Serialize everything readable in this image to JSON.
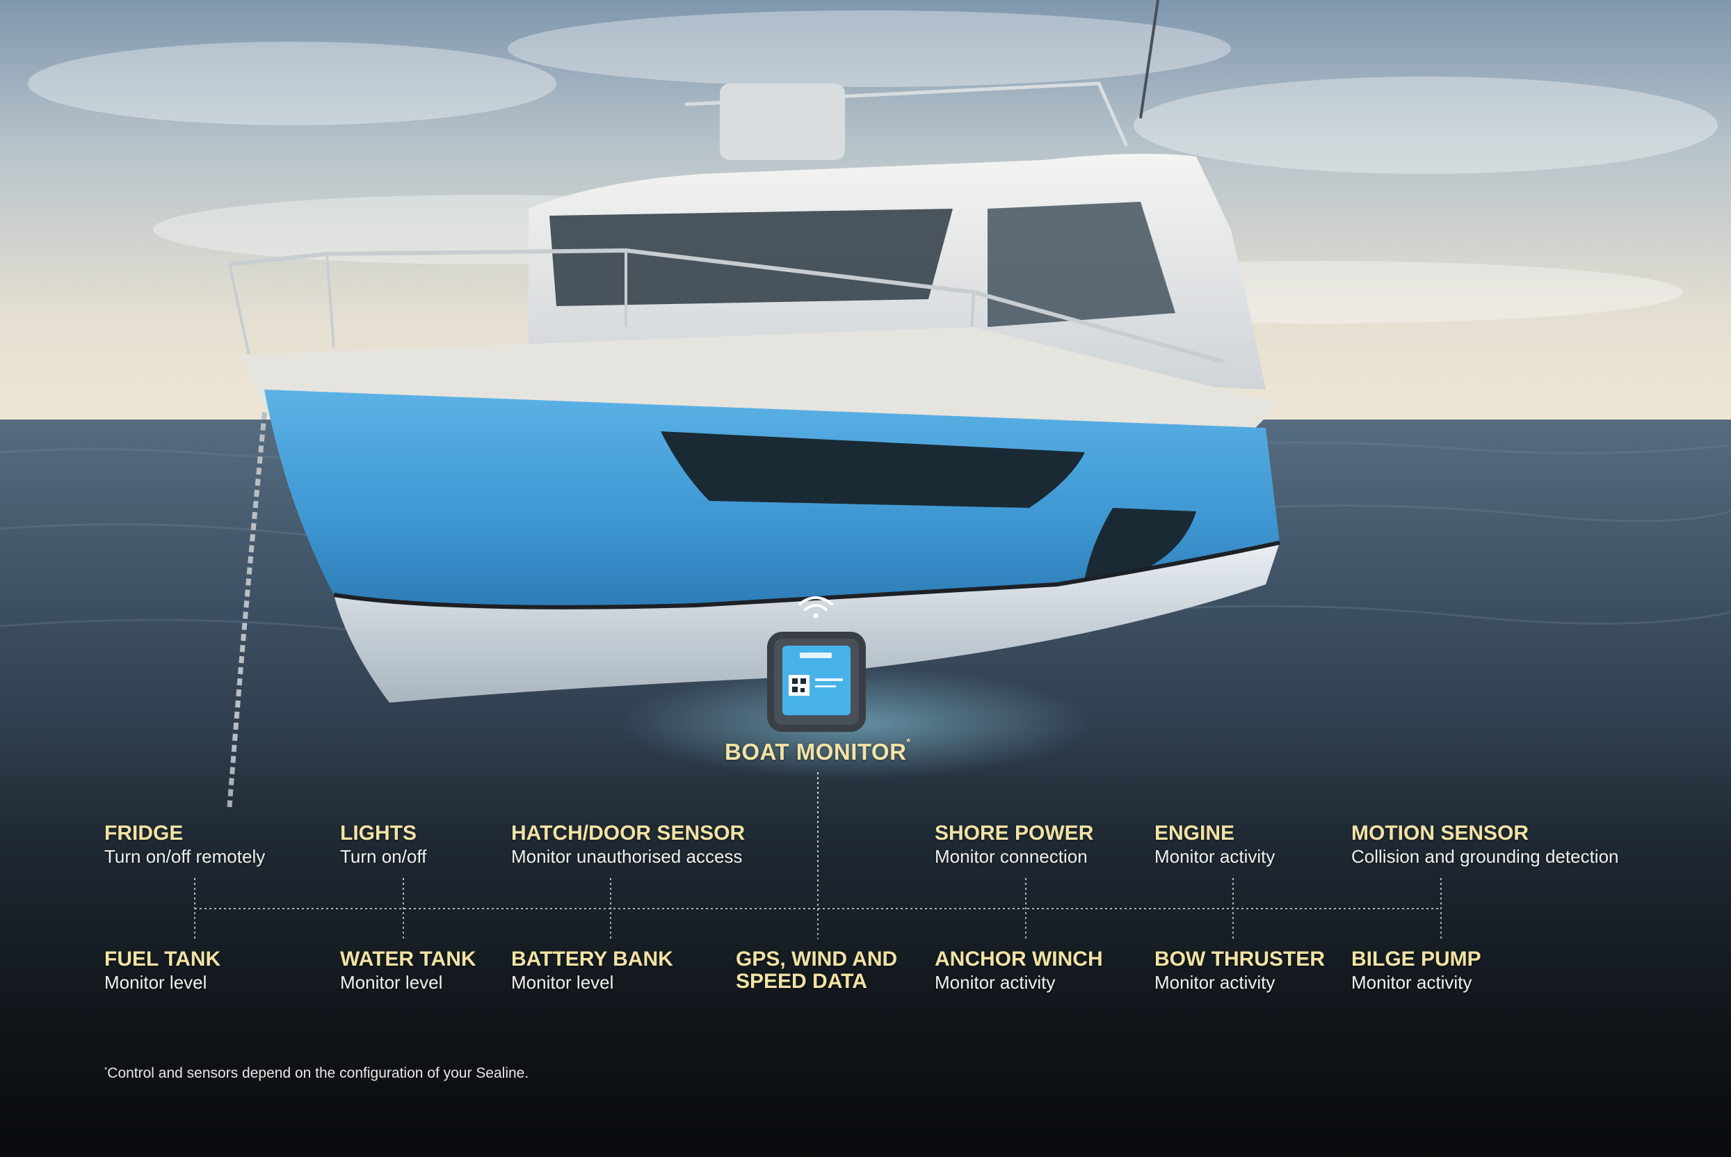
{
  "main_label": "BOAT MONITOR",
  "main_label_mark": "*",
  "features_top": [
    {
      "title": "FRIDGE",
      "desc": "Turn on/off remotely"
    },
    {
      "title": "LIGHTS",
      "desc": "Turn on/off"
    },
    {
      "title": "HATCH/DOOR SENSOR",
      "desc": "Monitor unauthorised access"
    },
    {
      "title": "SHORE POWER",
      "desc": "Monitor connection"
    },
    {
      "title": "ENGINE",
      "desc": "Monitor activity"
    },
    {
      "title": "MOTION SENSOR",
      "desc": "Collision and grounding detection"
    }
  ],
  "features_bottom": [
    {
      "title": "FUEL TANK",
      "desc": "Monitor level"
    },
    {
      "title": "WATER TANK",
      "desc": "Monitor level"
    },
    {
      "title": "BATTERY BANK",
      "desc": "Monitor level"
    },
    {
      "title_line1": "GPS, WIND AND",
      "title_line2": "SPEED DATA"
    },
    {
      "title": "ANCHOR WINCH",
      "desc": "Monitor activity"
    },
    {
      "title": "BOW THRUSTER",
      "desc": "Monitor activity"
    },
    {
      "title": "BILGE PUMP",
      "desc": "Monitor activity"
    }
  ],
  "footnote_mark": "*",
  "footnote": "Control and sensors depend on the configuration of your Sealine.",
  "colors": {
    "accent_gold": "#f2e3a4",
    "hull_blue": "#3e97d2",
    "sea_dark": "#1c2834"
  }
}
